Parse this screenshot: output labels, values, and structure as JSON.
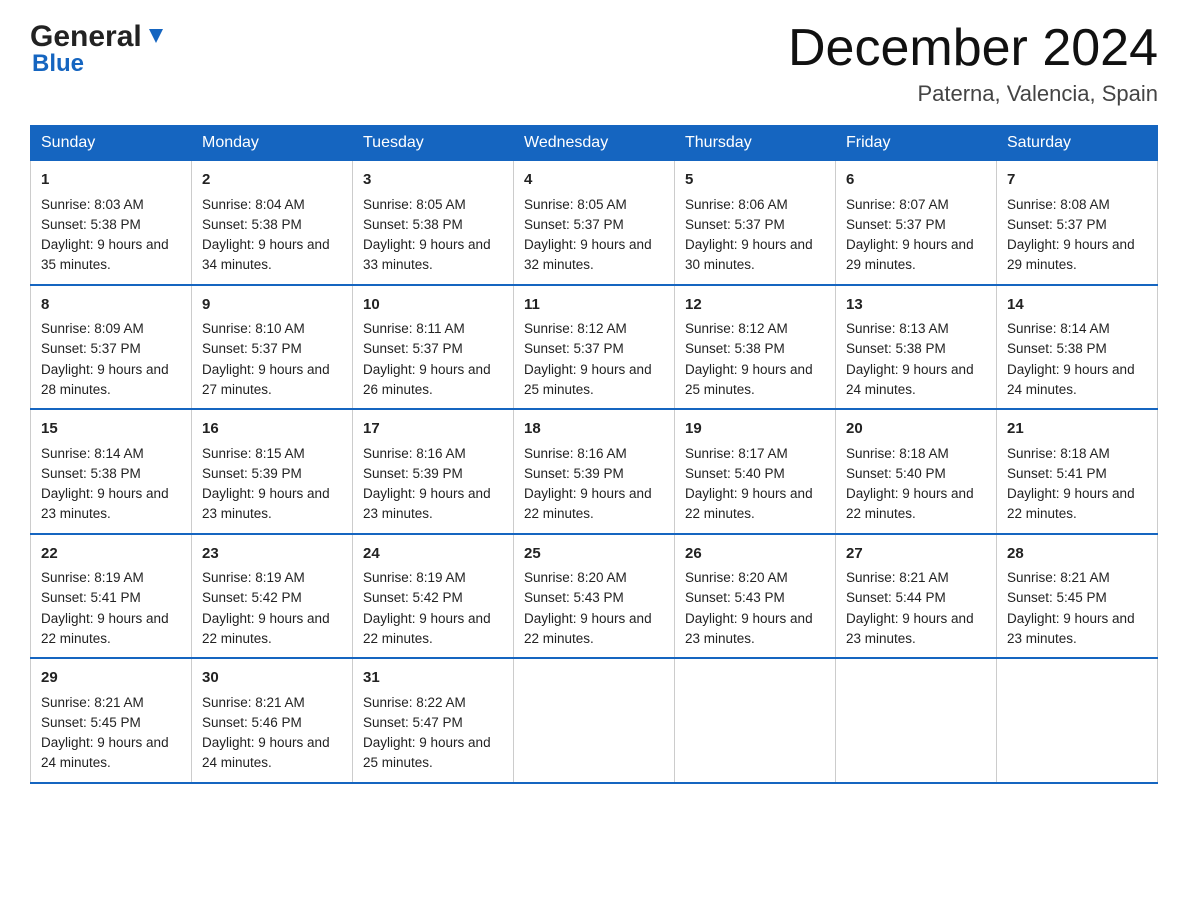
{
  "header": {
    "logo_general": "General",
    "logo_blue": "Blue",
    "month_title": "December 2024",
    "location": "Paterna, Valencia, Spain"
  },
  "columns": [
    "Sunday",
    "Monday",
    "Tuesday",
    "Wednesday",
    "Thursday",
    "Friday",
    "Saturday"
  ],
  "weeks": [
    [
      {
        "day": "1",
        "sunrise": "8:03 AM",
        "sunset": "5:38 PM",
        "daylight": "9 hours and 35 minutes."
      },
      {
        "day": "2",
        "sunrise": "8:04 AM",
        "sunset": "5:38 PM",
        "daylight": "9 hours and 34 minutes."
      },
      {
        "day": "3",
        "sunrise": "8:05 AM",
        "sunset": "5:38 PM",
        "daylight": "9 hours and 33 minutes."
      },
      {
        "day": "4",
        "sunrise": "8:05 AM",
        "sunset": "5:37 PM",
        "daylight": "9 hours and 32 minutes."
      },
      {
        "day": "5",
        "sunrise": "8:06 AM",
        "sunset": "5:37 PM",
        "daylight": "9 hours and 30 minutes."
      },
      {
        "day": "6",
        "sunrise": "8:07 AM",
        "sunset": "5:37 PM",
        "daylight": "9 hours and 29 minutes."
      },
      {
        "day": "7",
        "sunrise": "8:08 AM",
        "sunset": "5:37 PM",
        "daylight": "9 hours and 29 minutes."
      }
    ],
    [
      {
        "day": "8",
        "sunrise": "8:09 AM",
        "sunset": "5:37 PM",
        "daylight": "9 hours and 28 minutes."
      },
      {
        "day": "9",
        "sunrise": "8:10 AM",
        "sunset": "5:37 PM",
        "daylight": "9 hours and 27 minutes."
      },
      {
        "day": "10",
        "sunrise": "8:11 AM",
        "sunset": "5:37 PM",
        "daylight": "9 hours and 26 minutes."
      },
      {
        "day": "11",
        "sunrise": "8:12 AM",
        "sunset": "5:37 PM",
        "daylight": "9 hours and 25 minutes."
      },
      {
        "day": "12",
        "sunrise": "8:12 AM",
        "sunset": "5:38 PM",
        "daylight": "9 hours and 25 minutes."
      },
      {
        "day": "13",
        "sunrise": "8:13 AM",
        "sunset": "5:38 PM",
        "daylight": "9 hours and 24 minutes."
      },
      {
        "day": "14",
        "sunrise": "8:14 AM",
        "sunset": "5:38 PM",
        "daylight": "9 hours and 24 minutes."
      }
    ],
    [
      {
        "day": "15",
        "sunrise": "8:14 AM",
        "sunset": "5:38 PM",
        "daylight": "9 hours and 23 minutes."
      },
      {
        "day": "16",
        "sunrise": "8:15 AM",
        "sunset": "5:39 PM",
        "daylight": "9 hours and 23 minutes."
      },
      {
        "day": "17",
        "sunrise": "8:16 AM",
        "sunset": "5:39 PM",
        "daylight": "9 hours and 23 minutes."
      },
      {
        "day": "18",
        "sunrise": "8:16 AM",
        "sunset": "5:39 PM",
        "daylight": "9 hours and 22 minutes."
      },
      {
        "day": "19",
        "sunrise": "8:17 AM",
        "sunset": "5:40 PM",
        "daylight": "9 hours and 22 minutes."
      },
      {
        "day": "20",
        "sunrise": "8:18 AM",
        "sunset": "5:40 PM",
        "daylight": "9 hours and 22 minutes."
      },
      {
        "day": "21",
        "sunrise": "8:18 AM",
        "sunset": "5:41 PM",
        "daylight": "9 hours and 22 minutes."
      }
    ],
    [
      {
        "day": "22",
        "sunrise": "8:19 AM",
        "sunset": "5:41 PM",
        "daylight": "9 hours and 22 minutes."
      },
      {
        "day": "23",
        "sunrise": "8:19 AM",
        "sunset": "5:42 PM",
        "daylight": "9 hours and 22 minutes."
      },
      {
        "day": "24",
        "sunrise": "8:19 AM",
        "sunset": "5:42 PM",
        "daylight": "9 hours and 22 minutes."
      },
      {
        "day": "25",
        "sunrise": "8:20 AM",
        "sunset": "5:43 PM",
        "daylight": "9 hours and 22 minutes."
      },
      {
        "day": "26",
        "sunrise": "8:20 AM",
        "sunset": "5:43 PM",
        "daylight": "9 hours and 23 minutes."
      },
      {
        "day": "27",
        "sunrise": "8:21 AM",
        "sunset": "5:44 PM",
        "daylight": "9 hours and 23 minutes."
      },
      {
        "day": "28",
        "sunrise": "8:21 AM",
        "sunset": "5:45 PM",
        "daylight": "9 hours and 23 minutes."
      }
    ],
    [
      {
        "day": "29",
        "sunrise": "8:21 AM",
        "sunset": "5:45 PM",
        "daylight": "9 hours and 24 minutes."
      },
      {
        "day": "30",
        "sunrise": "8:21 AM",
        "sunset": "5:46 PM",
        "daylight": "9 hours and 24 minutes."
      },
      {
        "day": "31",
        "sunrise": "8:22 AM",
        "sunset": "5:47 PM",
        "daylight": "9 hours and 25 minutes."
      },
      null,
      null,
      null,
      null
    ]
  ]
}
